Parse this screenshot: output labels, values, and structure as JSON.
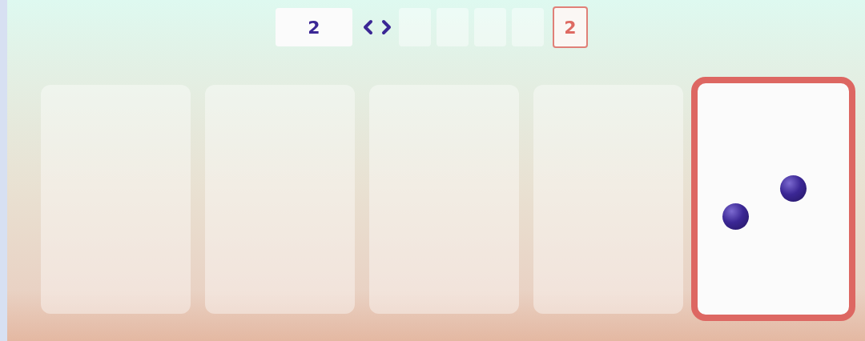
{
  "answer": {
    "value": "2"
  },
  "slots": [
    {
      "selected": false
    },
    {
      "selected": false
    },
    {
      "selected": false
    },
    {
      "selected": false
    },
    {
      "selected": true,
      "value": "2"
    }
  ],
  "cards": [
    {
      "selected": false
    },
    {
      "selected": false
    },
    {
      "selected": false
    },
    {
      "selected": false
    },
    {
      "selected": true,
      "balls": [
        {
          "kind": "ball"
        },
        {
          "kind": "ball"
        }
      ]
    }
  ]
}
